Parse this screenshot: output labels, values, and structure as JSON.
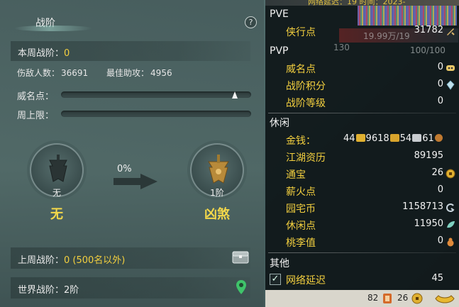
{
  "left_panel": {
    "title": "战阶",
    "help_label": "?",
    "weekly_tier_label": "本周战阶：",
    "weekly_tier_value": "0",
    "enemies_label": "伤敌人数：",
    "enemies_value": "36691",
    "assists_label": "最佳助攻：",
    "assists_value": "4956",
    "prestige_label": "威名点：",
    "weekly_cap_label": "周上限：",
    "progress_percent": "0%",
    "current_badge_level": "无",
    "current_tier_name": "无",
    "next_badge_level": "1阶",
    "next_tier_name": "凶煞",
    "last_week_label": "上周战阶：",
    "last_week_value": "0 (500名以外)",
    "world_label": "世界战阶：",
    "world_value": "2阶"
  },
  "right_panel": {
    "hud_partial": "网络延迟：19 时间：2023-",
    "overlay_hp": "19.99万/19",
    "overlay_level": "130",
    "overlay_mana": "100/100",
    "pve": {
      "title": "PVE",
      "rows": [
        {
          "label": "侠行点",
          "value": "31782",
          "icon": "sword-icon"
        }
      ]
    },
    "pvp": {
      "title": "PVP",
      "rows": [
        {
          "label": "威名点",
          "value": "0",
          "icon": "mask-icon"
        },
        {
          "label": "战阶积分",
          "value": "0",
          "icon": "crystal-icon"
        },
        {
          "label": "战阶等级",
          "value": "0",
          "icon": ""
        }
      ]
    },
    "leisure": {
      "title": "休闲",
      "money_label": "金钱：",
      "money_gold": "44",
      "money_silver_ingot": "9618",
      "money_silver": "54",
      "money_copper": "61",
      "rows": [
        {
          "label": "江湖资历",
          "value": "89195",
          "icon": ""
        },
        {
          "label": "通宝",
          "value": "26",
          "icon": "coin-icon"
        },
        {
          "label": "薪火点",
          "value": "0",
          "icon": ""
        },
        {
          "label": "园宅币",
          "value": "1158713",
          "icon": "swirl-icon"
        },
        {
          "label": "休闲点",
          "value": "11950",
          "icon": "leaf-icon"
        },
        {
          "label": "桃李值",
          "value": "0",
          "icon": "gourd-icon"
        }
      ]
    },
    "other": {
      "title": "其他",
      "network_label": "网络延迟",
      "network_value": "45"
    },
    "bottom_bar": {
      "count_a": "82",
      "count_b": "26"
    }
  },
  "colors": {
    "accent_yellow": "#f4d03f",
    "panel_teal": "#50686a",
    "right_panel_bg": "#0e1618"
  }
}
